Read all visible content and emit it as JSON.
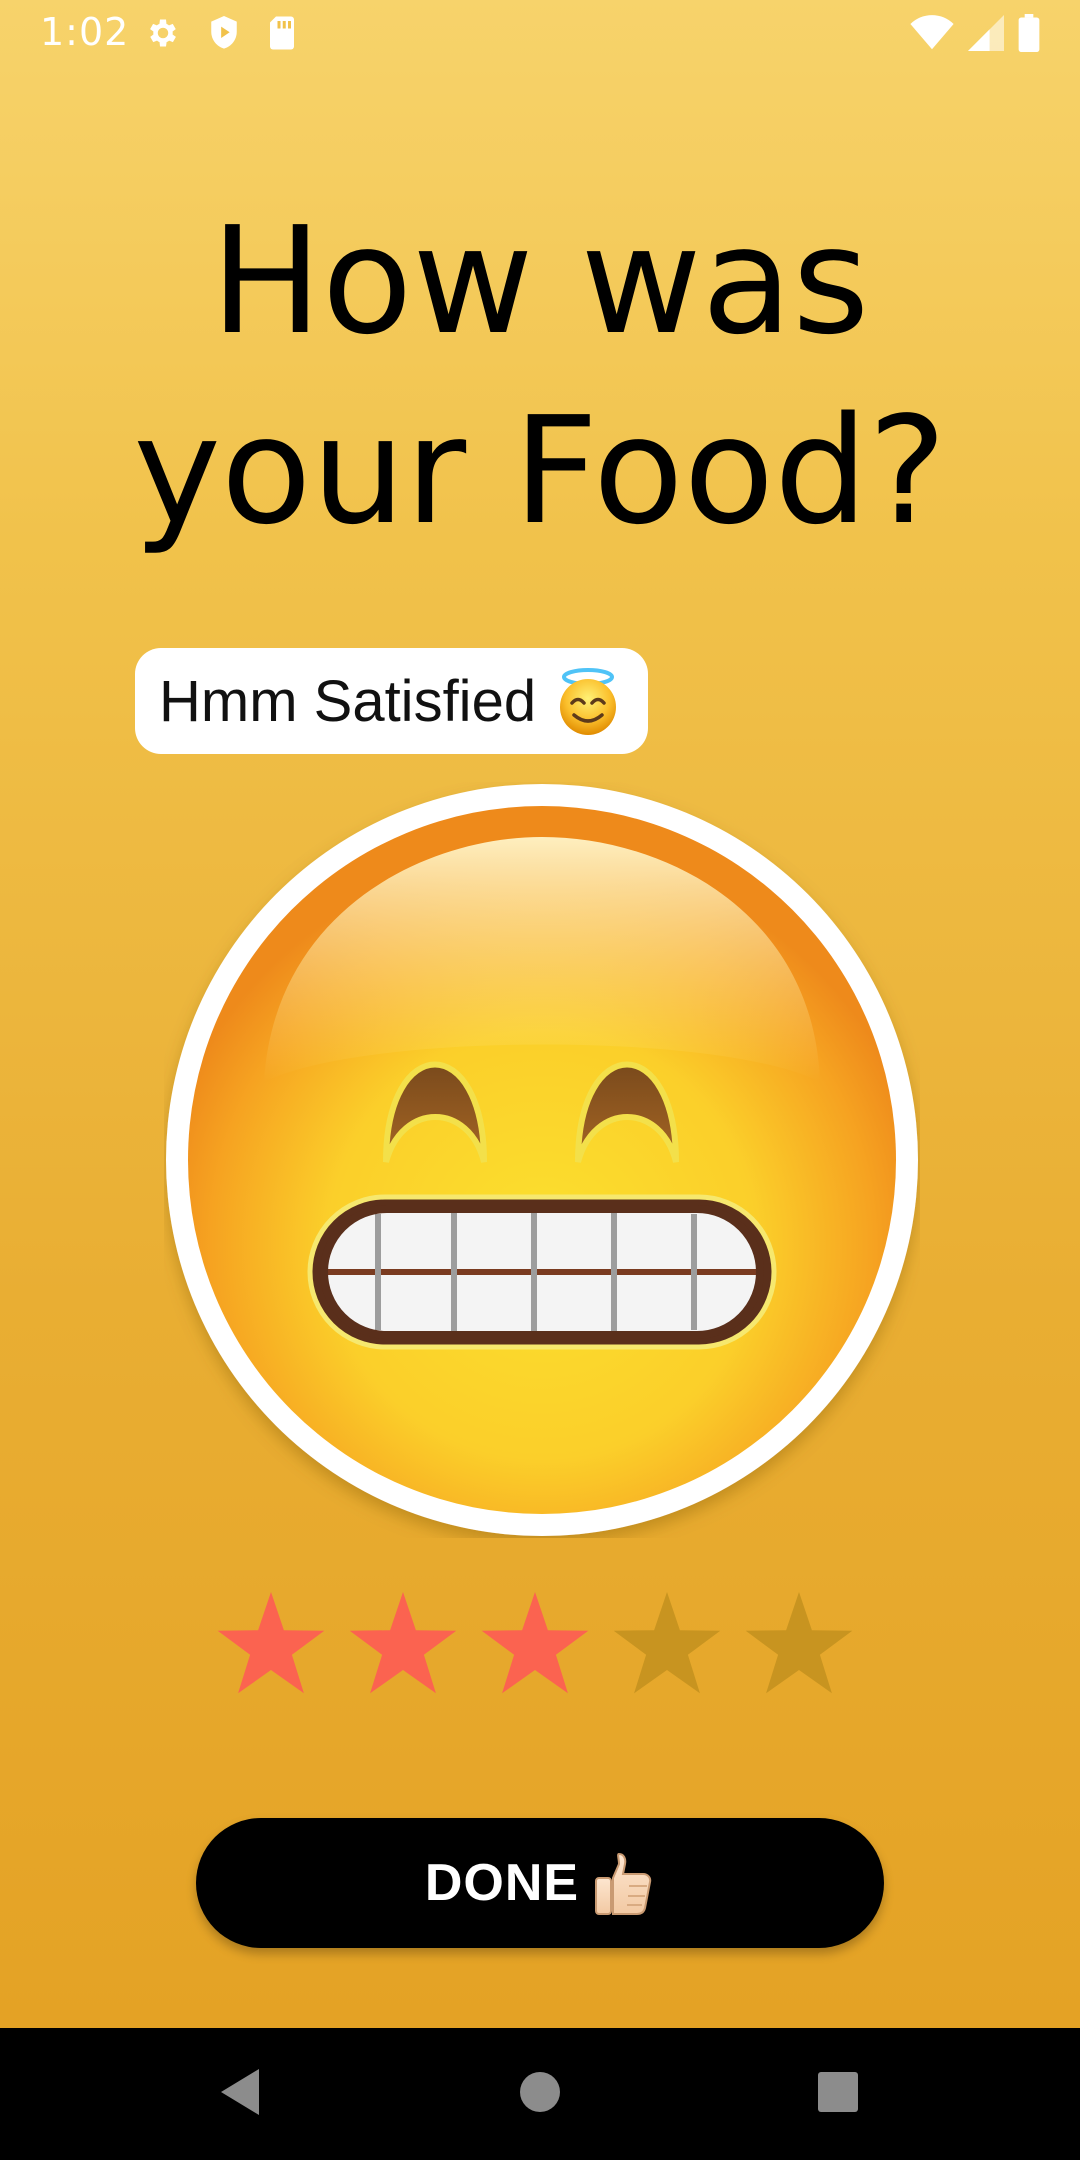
{
  "status_bar": {
    "time": "1:02",
    "left_icons": [
      "gear-icon",
      "shield-play-icon",
      "sd-card-icon"
    ],
    "right_icons": [
      "wifi-icon",
      "cell-signal-icon",
      "battery-icon"
    ]
  },
  "title": {
    "line1": "How was",
    "line2": "your Food?"
  },
  "feedback": {
    "text": "Hmm Satisfied",
    "emoji": "smiling-face-with-halo-icon"
  },
  "main_emoji": "grinning-face-with-smiling-eyes-icon",
  "rating": {
    "value": 3,
    "max": 5,
    "active_color": "#fb6350",
    "inactive_color": "#c89420"
  },
  "done_button": {
    "label": "DONE",
    "emoji": "thumbs-up-icon"
  },
  "colors": {
    "background_top": "#f7d36b",
    "background_bottom": "#e3a022",
    "button": "#000000"
  },
  "nav_bar": {
    "icons": [
      "back-icon",
      "home-icon",
      "recents-icon"
    ]
  }
}
